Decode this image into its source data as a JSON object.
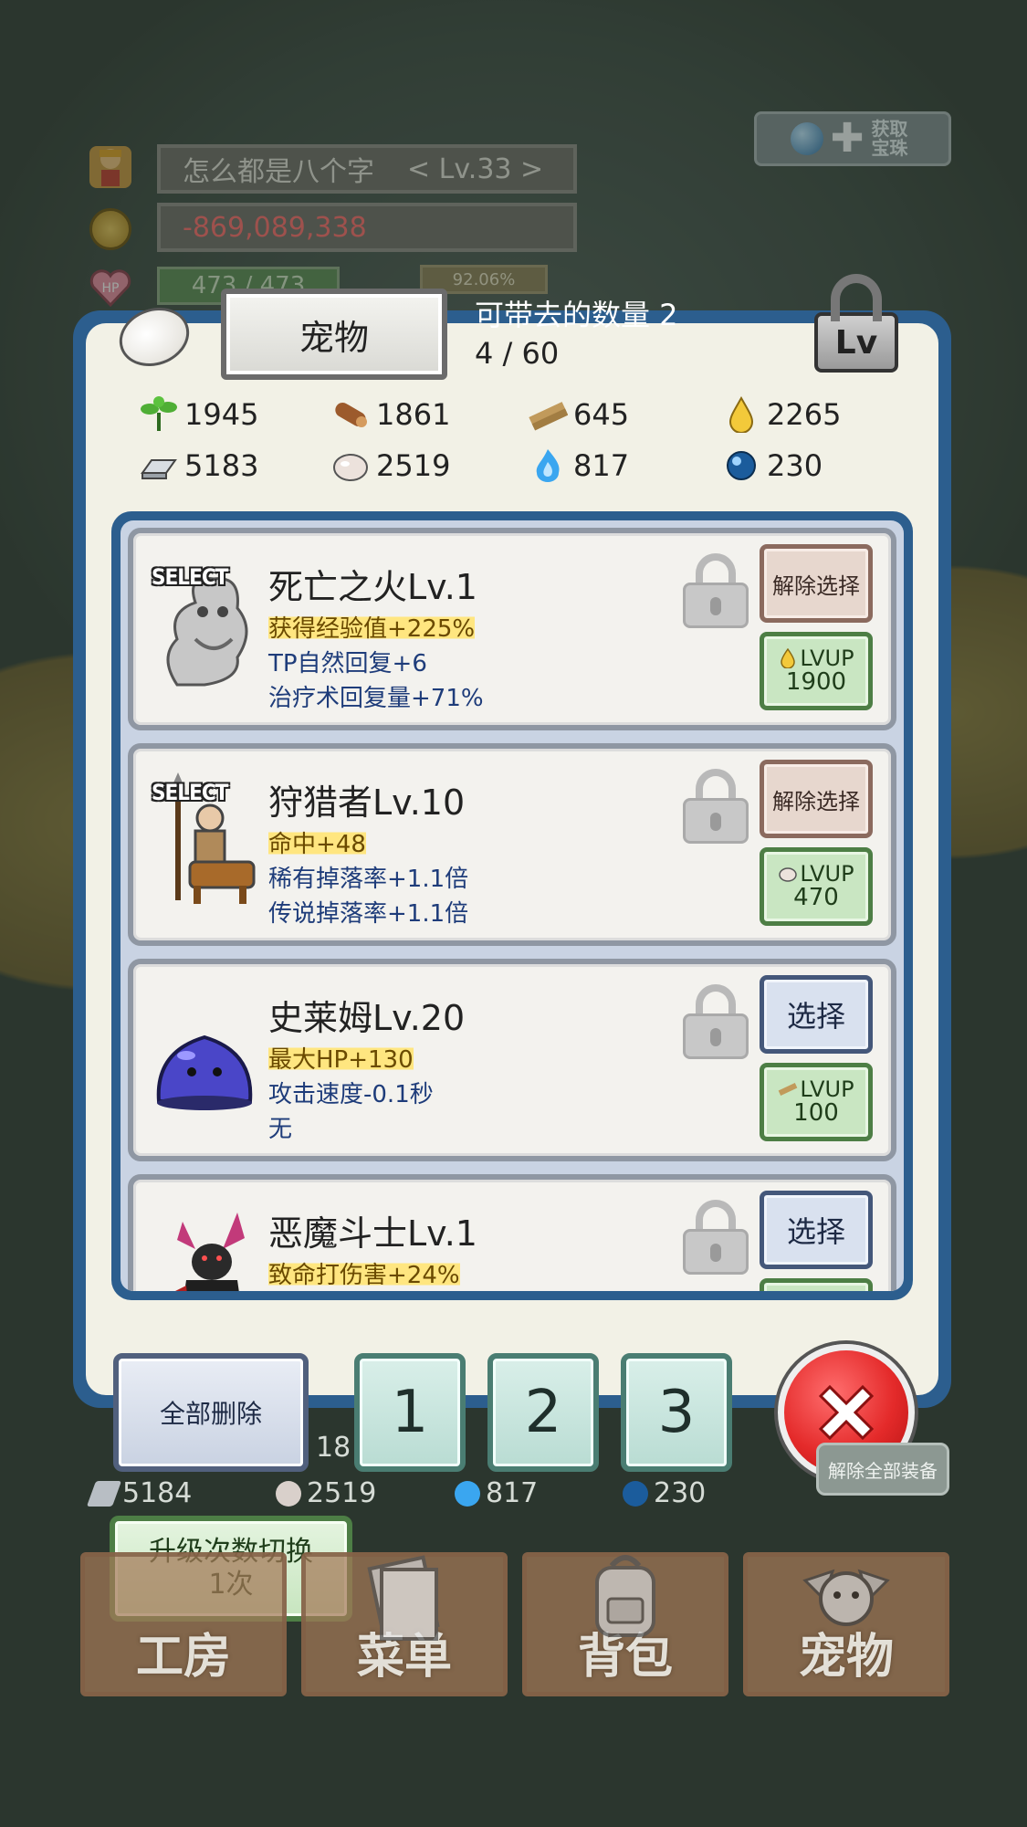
{
  "header": {
    "player_name": "怎么都是八个字",
    "player_level": "< Lv.33 >",
    "gold": "-869,089,338",
    "hp": "473 / 473",
    "hp_icon_label": "HP",
    "sp_percent": "92.06%",
    "get_gem_label": "获取宝珠"
  },
  "panel": {
    "title": "宠物",
    "carry_label": "可带去的数量 2",
    "count": "4 / 60",
    "lv_lock_label": "Lv"
  },
  "resources": [
    {
      "icon": "herb-icon",
      "value": "1945"
    },
    {
      "icon": "wood-log-icon",
      "value": "1861"
    },
    {
      "icon": "plank-icon",
      "value": "645"
    },
    {
      "icon": "oil-drop-icon",
      "value": "2265"
    },
    {
      "icon": "iron-ingot-icon",
      "value": "5183"
    },
    {
      "icon": "stone-icon",
      "value": "2519"
    },
    {
      "icon": "blue-flame-icon",
      "value": "817"
    },
    {
      "icon": "blue-orb-icon",
      "value": "230"
    }
  ],
  "pets": [
    {
      "selected_tag": "SELECT",
      "name": "死亡之火Lv.1",
      "effect1": "获得经验值+225%",
      "effect2": "TP自然回复+6",
      "effect3": "治疗术回复量+71%",
      "action_label": "解除选择",
      "lvup_label": "LVUP",
      "lvup_cost": "1900",
      "lvup_material_icon": "oil-drop-icon"
    },
    {
      "selected_tag": "SELECT",
      "name": "狩猎者Lv.10",
      "effect1": "命中+48",
      "effect2": "稀有掉落率+1.1倍",
      "effect3": "传说掉落率+1.1倍",
      "action_label": "解除选择",
      "lvup_label": "LVUP",
      "lvup_cost": "470",
      "lvup_material_icon": "stone-icon"
    },
    {
      "selected_tag": "",
      "name": "史莱姆Lv.20",
      "effect1": "最大HP+130",
      "effect2": "攻击速度-0.1秒",
      "effect3": "无",
      "action_label": "选择",
      "lvup_label": "LVUP",
      "lvup_cost": "100",
      "lvup_material_icon": "plank-icon"
    },
    {
      "selected_tag": "",
      "name": "恶魔斗士Lv.1",
      "effect1": "致命打伤害+24%",
      "effect2": "",
      "effect3": "",
      "action_label": "选择",
      "lvup_label": "",
      "lvup_cost": "",
      "lvup_material_icon": ""
    }
  ],
  "controls": {
    "delete_all": "全部删除",
    "preset1": "1",
    "preset2": "2",
    "preset3": "3"
  },
  "lower_hud": {
    "partial_value": "18",
    "res1": "5184",
    "res2": "2519",
    "res3": "817",
    "res4": "230",
    "unequip_all": "解除全部装备",
    "upgrade_toggle_line1": "升级次数切换",
    "upgrade_toggle_line2": "1次"
  },
  "nav": [
    {
      "label": "工房",
      "icon": "workshop-icon"
    },
    {
      "label": "菜单",
      "icon": "menu-book-icon"
    },
    {
      "label": "背包",
      "icon": "backpack-icon"
    },
    {
      "label": "宠物",
      "icon": "pet-dragon-icon"
    }
  ],
  "colors": {
    "panel_frame": "#2c5e8e",
    "panel_bg": "#f2f1e6",
    "negative_gold": "#ff6a6a",
    "highlight_effect": "#ffe680",
    "close_red": "#e42a2a"
  }
}
